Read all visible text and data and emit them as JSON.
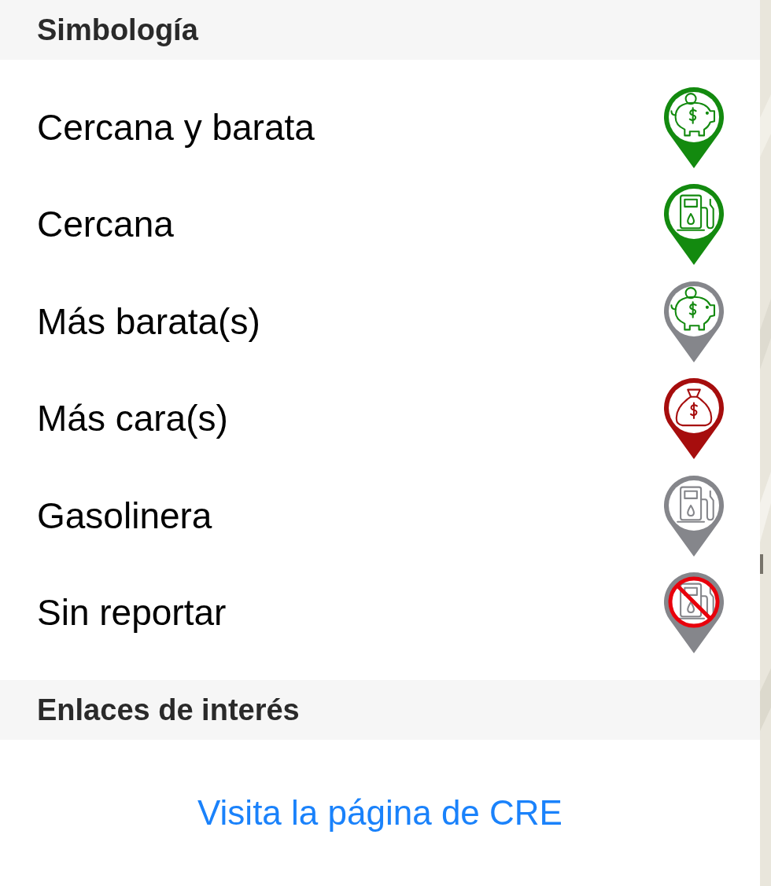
{
  "sections": [
    {
      "title": "Simbología",
      "items": [
        {
          "label": "Cercana y barata",
          "kind": "piggy",
          "color": "#138a0f"
        },
        {
          "label": "Cercana",
          "kind": "pump",
          "color": "#138a0f"
        },
        {
          "label": "Más barata(s)",
          "kind": "piggy",
          "color": "#85868b"
        },
        {
          "label": "Más cara(s)",
          "kind": "bag",
          "color": "#a60d0d"
        },
        {
          "label": "Gasolinera",
          "kind": "pump",
          "color": "#85868b"
        },
        {
          "label": "Sin reportar",
          "kind": "no-pump",
          "color": "#85868b"
        }
      ]
    },
    {
      "title": "Enlaces de interés",
      "links": [
        "Visita la página de CRE"
      ]
    }
  ]
}
